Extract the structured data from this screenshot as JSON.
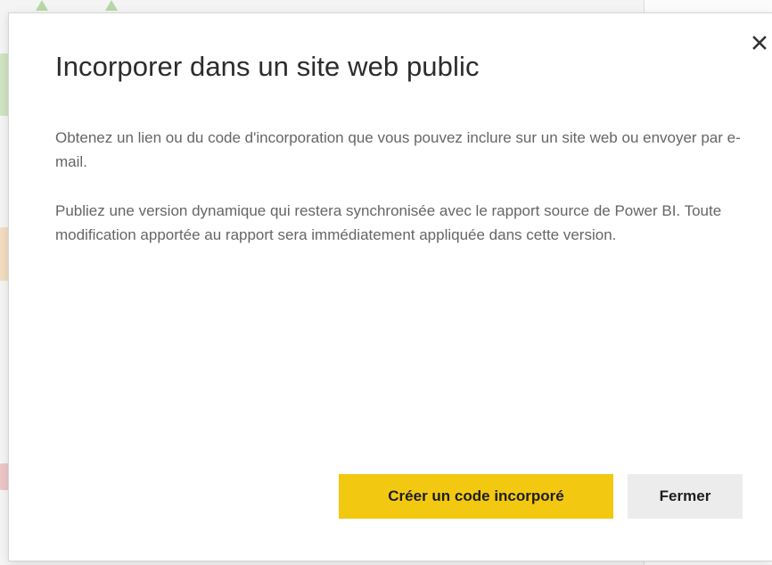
{
  "dialog": {
    "title": "Incorporer dans un site web public",
    "paragraphs": [
      "Obtenez un lien ou du code d'incorporation que vous pouvez inclure sur un site web ou envoyer par e-mail.",
      "Publiez une version dynamique qui restera synchronisée avec le rapport source de Power BI. Toute modification apportée au rapport sera immédiatement appliquée dans cette version."
    ],
    "close_icon": "close-icon",
    "primary_button_label": "Créer un code incorporé",
    "secondary_button_label": "Fermer"
  },
  "colors": {
    "primary_button": "#f2c811",
    "secondary_button": "#ececec",
    "title_text": "#2c2c2c",
    "body_text": "#666666"
  }
}
